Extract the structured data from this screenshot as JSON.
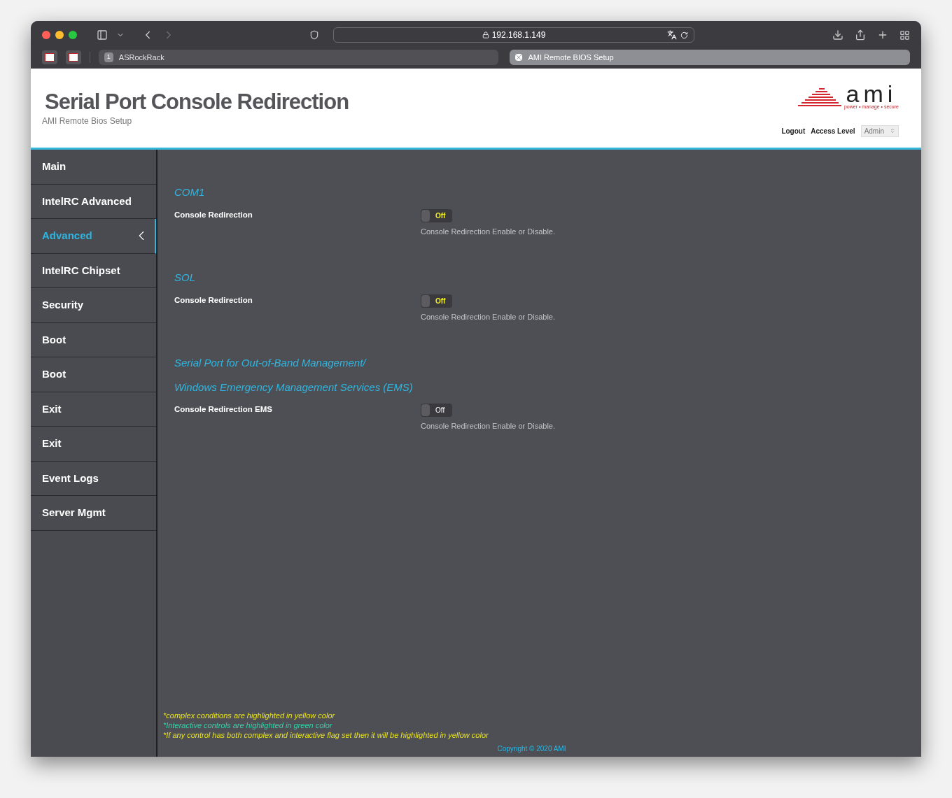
{
  "browser": {
    "address": "192.168.1.149",
    "tabs": [
      {
        "label": "ASRockRack",
        "badge": "1",
        "selected": false
      },
      {
        "label": "AMI Remote BIOS Setup",
        "selected": true
      }
    ]
  },
  "header": {
    "title": "Serial Port Console Redirection",
    "subtitle": "AMI Remote Bios Setup",
    "logo_text": "ami",
    "logo_tagline": "power • manage • secure",
    "logout": "Logout",
    "access_label": "Access Level",
    "access_value": "Admin"
  },
  "sidebar": {
    "items": [
      {
        "label": "Main",
        "selected": false
      },
      {
        "label": "IntelRC Advanced",
        "selected": false
      },
      {
        "label": "Advanced",
        "selected": true
      },
      {
        "label": "IntelRC Chipset",
        "selected": false
      },
      {
        "label": "Security",
        "selected": false
      },
      {
        "label": "Boot",
        "selected": false
      },
      {
        "label": "Boot",
        "selected": false
      },
      {
        "label": "Exit",
        "selected": false
      },
      {
        "label": "Exit",
        "selected": false
      },
      {
        "label": "Event Logs",
        "selected": false
      },
      {
        "label": "Server Mgmt",
        "selected": false
      }
    ]
  },
  "sections": [
    {
      "headings": [
        "COM1"
      ],
      "setting": {
        "label": "Console Redirection",
        "toggle": "Off",
        "on": false,
        "complex": true,
        "help": "Console Redirection Enable or Disable."
      }
    },
    {
      "headings": [
        "SOL"
      ],
      "setting": {
        "label": "Console Redirection",
        "toggle": "Off",
        "on": false,
        "complex": true,
        "help": "Console Redirection Enable or Disable."
      }
    },
    {
      "headings": [
        "Serial Port for Out-of-Band Management/",
        "Windows Emergency Management Services (EMS)"
      ],
      "setting": {
        "label": "Console Redirection EMS",
        "toggle": "Off",
        "on": false,
        "complex": false,
        "help": "Console Redirection Enable or Disable."
      }
    }
  ],
  "notes": [
    {
      "text": "*complex conditions are highlighted in yellow color",
      "color": "#e8e21e"
    },
    {
      "text": "*Interactive controls are highlighted in green color",
      "color": "#35d0a8"
    },
    {
      "text": "*If any control has both complex and interactive flag set then it will be highlighted in yellow color",
      "color": "#e8e21e"
    }
  ],
  "copyright": "Copyright © 2020 AMI"
}
